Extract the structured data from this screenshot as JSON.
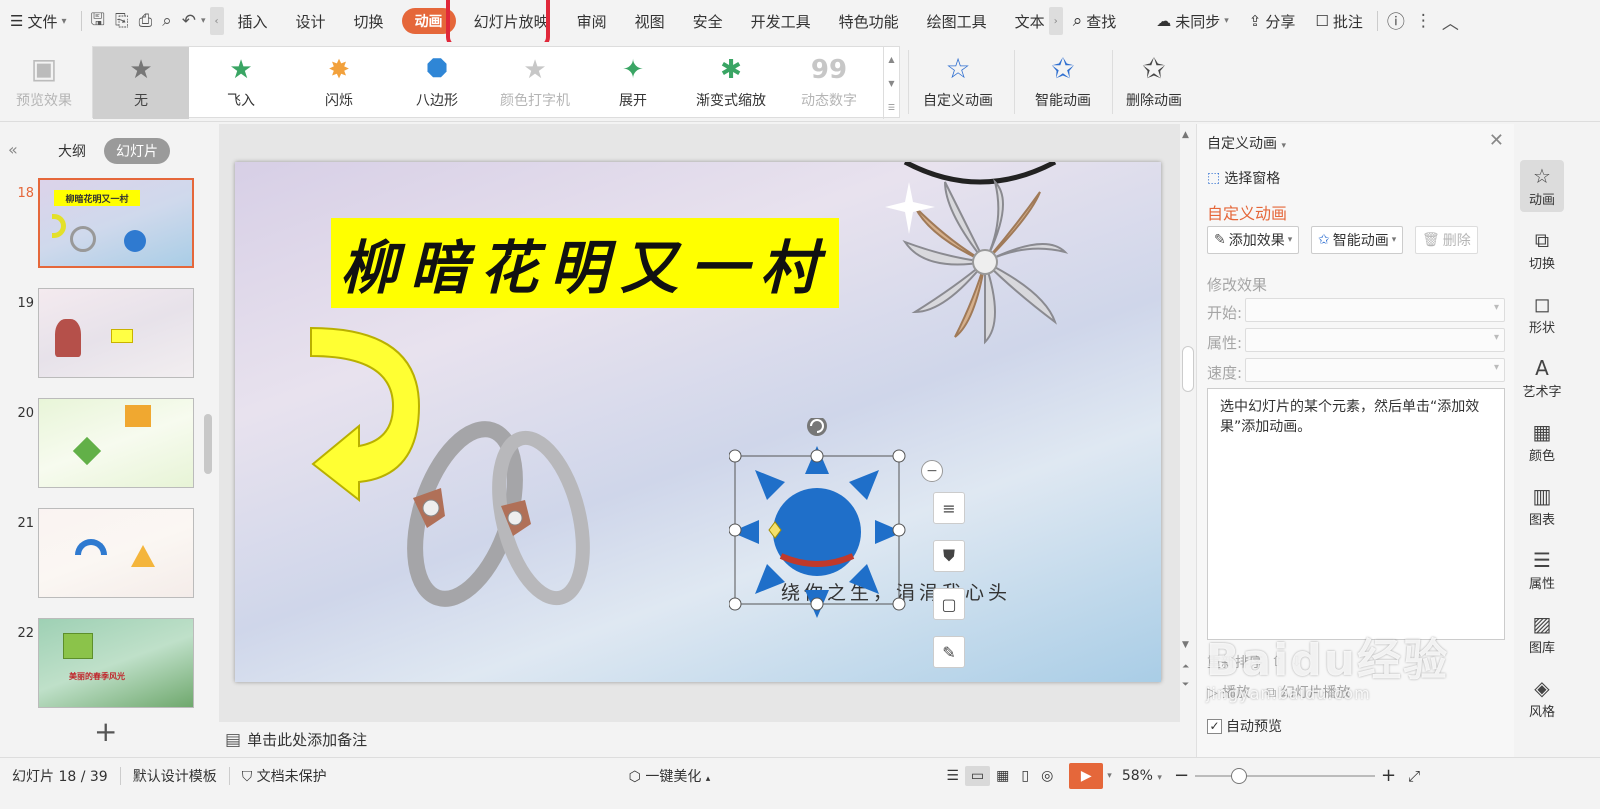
{
  "menubar": {
    "file_label": "文件",
    "tabs": [
      {
        "label": "插入"
      },
      {
        "label": "设计"
      },
      {
        "label": "切换"
      },
      {
        "label": "动画"
      },
      {
        "label": "幻灯片放映"
      },
      {
        "label": "审阅"
      },
      {
        "label": "视图"
      },
      {
        "label": "安全"
      },
      {
        "label": "开发工具"
      },
      {
        "label": "特色功能"
      },
      {
        "label": "绘图工具"
      },
      {
        "label": "文本"
      }
    ],
    "search_label": "查找",
    "sync_label": "未同步",
    "share_label": "分享",
    "comment_label": "批注"
  },
  "ribbon": {
    "preview_label": "预览效果",
    "gallery": [
      {
        "label": "无",
        "icon": "star-icon"
      },
      {
        "label": "飞入",
        "icon": "fly-in-icon"
      },
      {
        "label": "闪烁",
        "icon": "flash-icon"
      },
      {
        "label": "八边形",
        "icon": "octagon-icon"
      },
      {
        "label": "颜色打字机",
        "icon": "typewriter-icon"
      },
      {
        "label": "展开",
        "icon": "expand-icon"
      },
      {
        "label": "渐变式缩放",
        "icon": "zoom-icon"
      },
      {
        "label": "动态数字",
        "icon": "number-icon"
      }
    ],
    "custom_label": "自定义动画",
    "smart_label": "智能动画",
    "delete_label": "删除动画"
  },
  "left_panel": {
    "outline_label": "大纲",
    "slides_label": "幻灯片",
    "slide_numbers": [
      "18",
      "19",
      "20",
      "21",
      "22"
    ],
    "thumb_texts": {
      "t18": "柳暗花明又一村",
      "t22": "美丽的春季风光"
    }
  },
  "slide": {
    "title": "柳暗花明又一村",
    "caption": "绕你之生，涓涓我心头"
  },
  "notes": {
    "placeholder": "单击此处添加备注"
  },
  "right_panel": {
    "header": "自定义动画",
    "select_pane": "选择窗格",
    "title": "自定义动画",
    "add_effect": "添加效果",
    "smart_anim": "智能动画",
    "delete": "删除",
    "modify_label": "修改效果",
    "start_label": "开始:",
    "property_label": "属性:",
    "speed_label": "速度:",
    "hint": "选中幻灯片的某个元素，然后单击“添加效果”添加动画。",
    "reorder_label": "重新排序",
    "play_label": "播放",
    "slideshow_label": "幻灯片播放",
    "auto_preview": "自动预览"
  },
  "sidebar": {
    "items": [
      {
        "label": "动画",
        "icon": "animation-icon"
      },
      {
        "label": "切换",
        "icon": "switch-icon"
      },
      {
        "label": "形状",
        "icon": "shape-icon"
      },
      {
        "label": "艺术字",
        "icon": "art-text-icon"
      },
      {
        "label": "颜色",
        "icon": "color-icon"
      },
      {
        "label": "图表",
        "icon": "chart-icon"
      },
      {
        "label": "属性",
        "icon": "property-icon"
      },
      {
        "label": "图库",
        "icon": "gallery-icon"
      },
      {
        "label": "风格",
        "icon": "style-icon"
      }
    ]
  },
  "statusbar": {
    "slide_info": "幻灯片 18 / 39",
    "template": "默认设计模板",
    "protect": "文档未保护",
    "beautify": "一键美化",
    "zoom": "58%"
  },
  "watermark": {
    "main": "Baidu经验",
    "sub": "jingyan.baidu.com"
  }
}
